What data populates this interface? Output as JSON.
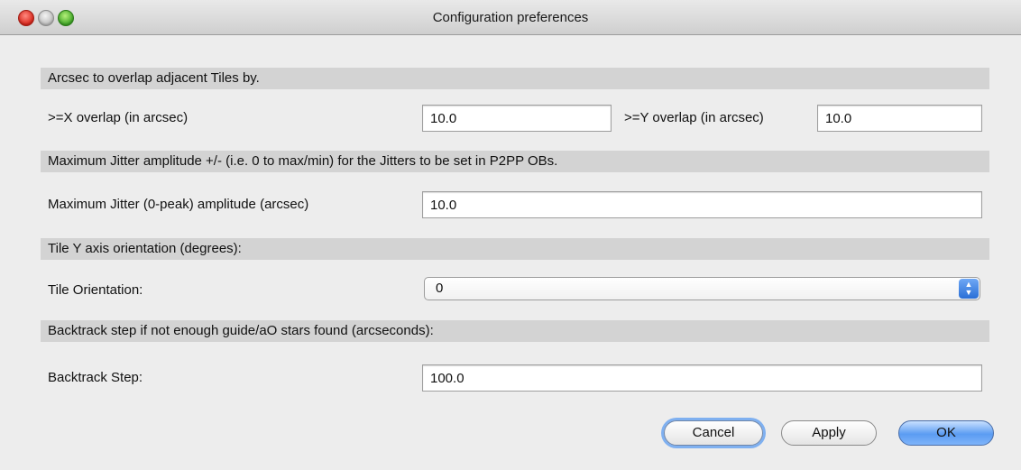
{
  "window": {
    "title": "Configuration preferences"
  },
  "sections": {
    "overlap": {
      "heading": "Arcsec to overlap adjacent Tiles by.",
      "x_label": ">=X overlap (in arcsec)",
      "x_value": "10.0",
      "y_label": ">=Y overlap (in arcsec)",
      "y_value": "10.0"
    },
    "jitter": {
      "heading": "Maximum Jitter amplitude +/- (i.e. 0 to max/min) for the Jitters to be set in P2PP OBs.",
      "label": "Maximum Jitter (0-peak) amplitude (arcsec)",
      "value": "10.0"
    },
    "orientation": {
      "heading": "Tile Y axis orientation (degrees):",
      "label": "Tile Orientation:",
      "selected": "0"
    },
    "backtrack": {
      "heading": "Backtrack step if not enough guide/aO stars found (arcseconds):",
      "label": "Backtrack Step:",
      "value": "100.0"
    }
  },
  "buttons": {
    "cancel": "Cancel",
    "apply": "Apply",
    "ok": "OK"
  },
  "icons": {
    "close": "close-traffic-light-icon",
    "minimize": "minimize-traffic-light-icon",
    "zoom": "zoom-traffic-light-icon",
    "select_arrows": "updown-arrows-icon"
  },
  "colors": {
    "ok_button": "#5b9cf2",
    "section_bar": "#d3d3d3",
    "close": "#d8261b",
    "zoom": "#3fa526"
  }
}
